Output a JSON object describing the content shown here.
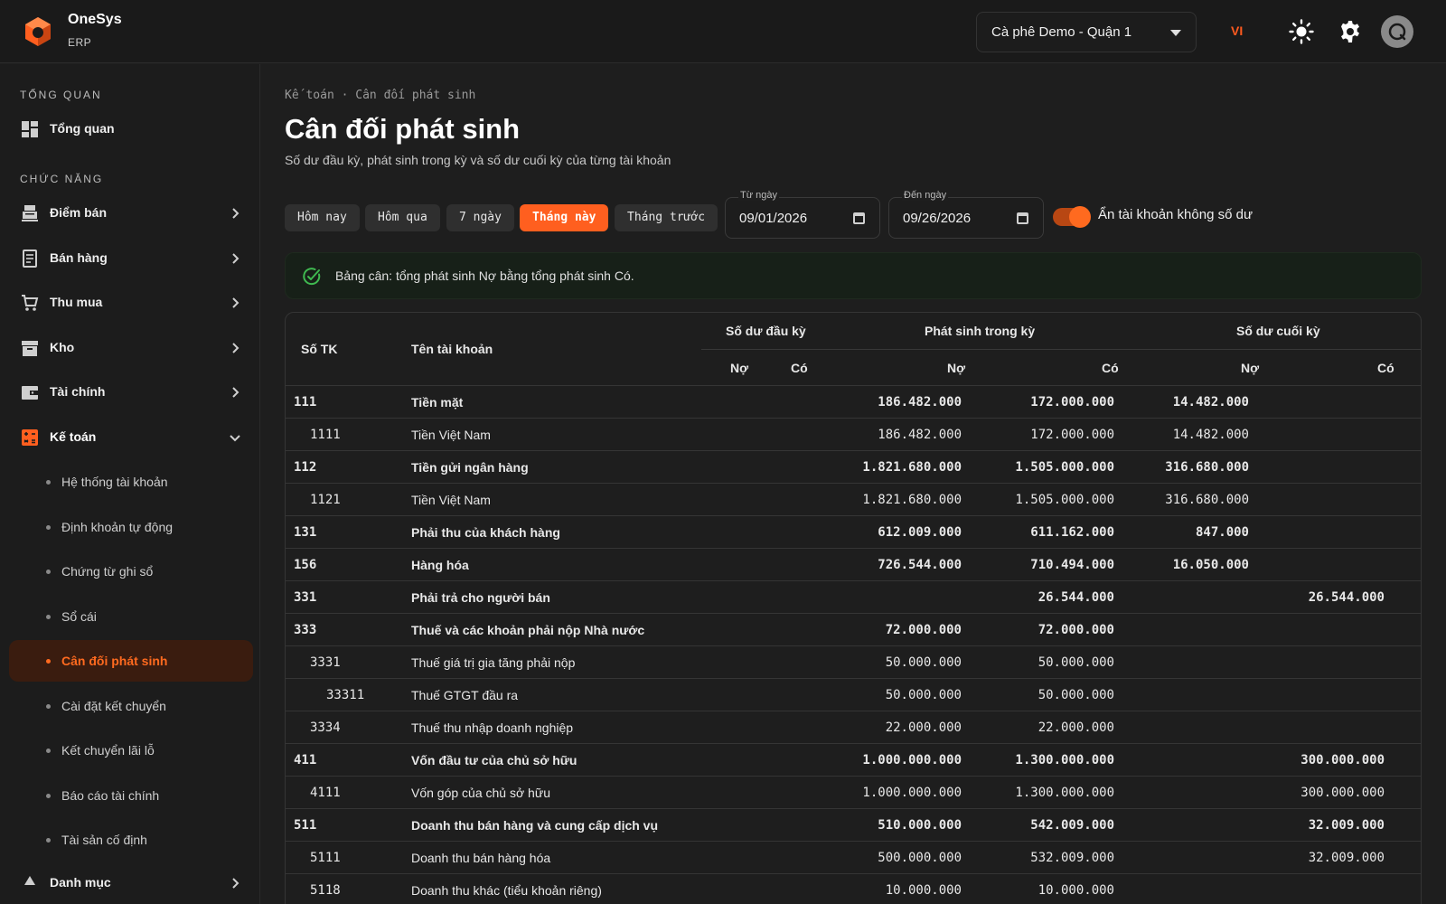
{
  "app": {
    "name": "OneSys",
    "sub": "ERP"
  },
  "header": {
    "store": "Cà phê Demo - Quận 1",
    "lang": "VI"
  },
  "sidebar": {
    "section1": "TỔNG QUAN",
    "overview": "Tổng quan",
    "section2": "CHỨC NĂNG",
    "items": [
      "Điểm bán",
      "Bán hàng",
      "Thu mua",
      "Kho",
      "Tài chính",
      "Kế toán"
    ],
    "sub_items": [
      "Hệ thống tài khoản",
      "Định khoản tự động",
      "Chứng từ ghi sổ",
      "Sổ cái",
      "Cân đối phát sinh",
      "Cài đặt kết chuyển",
      "Kết chuyển lãi lỗ",
      "Báo cáo tài chính",
      "Tài sản cố định"
    ],
    "next_item": "Danh mục"
  },
  "page": {
    "breadcrumb": "Kế toán · Cân đối phát sinh",
    "title": "Cân đối phát sinh",
    "subtitle": "Số dư đầu kỳ, phát sinh trong kỳ và số dư cuối kỳ của từng tài khoản"
  },
  "filters": {
    "chips": [
      "Hôm nay",
      "Hôm qua",
      "7 ngày",
      "Tháng này",
      "Tháng trước"
    ],
    "active_chip": "Tháng này",
    "from_label": "Từ ngày",
    "from_value": "09/01/2026",
    "to_label": "Đến ngày",
    "to_value": "09/26/2026",
    "toggle_label": "Ẩn tài khoản không số dư",
    "toggle_on": true
  },
  "alert": "Bảng cân: tổng phát sinh Nợ bằng tổng phát sinh Có.",
  "table": {
    "headers": {
      "account_no": "Số TK",
      "account_name": "Tên tài khoản",
      "opening": "Số dư đầu kỳ",
      "period": "Phát sinh trong kỳ",
      "closing": "Số dư cuối kỳ",
      "debit": "Nợ",
      "credit": "Có"
    },
    "rows": [
      {
        "no": "111",
        "name": "Tiền mặt",
        "level": 0,
        "bold": true,
        "od": "",
        "oc": "",
        "pd": "186.482.000",
        "pc": "172.000.000",
        "cd": "14.482.000",
        "cc": ""
      },
      {
        "no": "1111",
        "name": "Tiền Việt Nam",
        "level": 1,
        "bold": false,
        "od": "",
        "oc": "",
        "pd": "186.482.000",
        "pc": "172.000.000",
        "cd": "14.482.000",
        "cc": ""
      },
      {
        "no": "112",
        "name": "Tiền gửi ngân hàng",
        "level": 0,
        "bold": true,
        "od": "",
        "oc": "",
        "pd": "1.821.680.000",
        "pc": "1.505.000.000",
        "cd": "316.680.000",
        "cc": ""
      },
      {
        "no": "1121",
        "name": "Tiền Việt Nam",
        "level": 1,
        "bold": false,
        "od": "",
        "oc": "",
        "pd": "1.821.680.000",
        "pc": "1.505.000.000",
        "cd": "316.680.000",
        "cc": ""
      },
      {
        "no": "131",
        "name": "Phải thu của khách hàng",
        "level": 0,
        "bold": true,
        "od": "",
        "oc": "",
        "pd": "612.009.000",
        "pc": "611.162.000",
        "cd": "847.000",
        "cc": ""
      },
      {
        "no": "156",
        "name": "Hàng hóa",
        "level": 0,
        "bold": true,
        "od": "",
        "oc": "",
        "pd": "726.544.000",
        "pc": "710.494.000",
        "cd": "16.050.000",
        "cc": ""
      },
      {
        "no": "331",
        "name": "Phải trả cho người bán",
        "level": 0,
        "bold": true,
        "od": "",
        "oc": "",
        "pd": "",
        "pc": "26.544.000",
        "cd": "",
        "cc": "26.544.000"
      },
      {
        "no": "333",
        "name": "Thuế và các khoản phải nộp Nhà nước",
        "level": 0,
        "bold": true,
        "od": "",
        "oc": "",
        "pd": "72.000.000",
        "pc": "72.000.000",
        "cd": "",
        "cc": ""
      },
      {
        "no": "3331",
        "name": "Thuế giá trị gia tăng phải nộp",
        "level": 1,
        "bold": false,
        "od": "",
        "oc": "",
        "pd": "50.000.000",
        "pc": "50.000.000",
        "cd": "",
        "cc": ""
      },
      {
        "no": "33311",
        "name": "Thuế GTGT đầu ra",
        "level": 2,
        "bold": false,
        "od": "",
        "oc": "",
        "pd": "50.000.000",
        "pc": "50.000.000",
        "cd": "",
        "cc": ""
      },
      {
        "no": "3334",
        "name": "Thuế thu nhập doanh nghiệp",
        "level": 1,
        "bold": false,
        "od": "",
        "oc": "",
        "pd": "22.000.000",
        "pc": "22.000.000",
        "cd": "",
        "cc": ""
      },
      {
        "no": "411",
        "name": "Vốn đầu tư của chủ sở hữu",
        "level": 0,
        "bold": true,
        "od": "",
        "oc": "",
        "pd": "1.000.000.000",
        "pc": "1.300.000.000",
        "cd": "",
        "cc": "300.000.000"
      },
      {
        "no": "4111",
        "name": "Vốn góp của chủ sở hữu",
        "level": 1,
        "bold": false,
        "od": "",
        "oc": "",
        "pd": "1.000.000.000",
        "pc": "1.300.000.000",
        "cd": "",
        "cc": "300.000.000"
      },
      {
        "no": "511",
        "name": "Doanh thu bán hàng và cung cấp dịch vụ",
        "level": 0,
        "bold": true,
        "od": "",
        "oc": "",
        "pd": "510.000.000",
        "pc": "542.009.000",
        "cd": "",
        "cc": "32.009.000"
      },
      {
        "no": "5111",
        "name": "Doanh thu bán hàng hóa",
        "level": 1,
        "bold": false,
        "od": "",
        "oc": "",
        "pd": "500.000.000",
        "pc": "532.009.000",
        "cd": "",
        "cc": "32.009.000"
      },
      {
        "no": "5118",
        "name": "Doanh thu khác (tiểu khoản riêng)",
        "level": 1,
        "bold": false,
        "od": "",
        "oc": "",
        "pd": "10.000.000",
        "pc": "10.000.000",
        "cd": "",
        "cc": ""
      }
    ]
  },
  "colors": {
    "accent": "#ff5f1f",
    "success": "#3fb950",
    "bg": "#1e1e1e"
  },
  "icons": [
    "logo-icon",
    "chevron-down-icon",
    "sun-icon",
    "gear-icon",
    "avatar",
    "dashboard-icon",
    "pos-icon",
    "receipt-icon",
    "cart-icon",
    "warehouse-icon",
    "wallet-icon",
    "calculator-icon",
    "chevron-right-icon",
    "calendar-icon",
    "check-circle-icon"
  ]
}
